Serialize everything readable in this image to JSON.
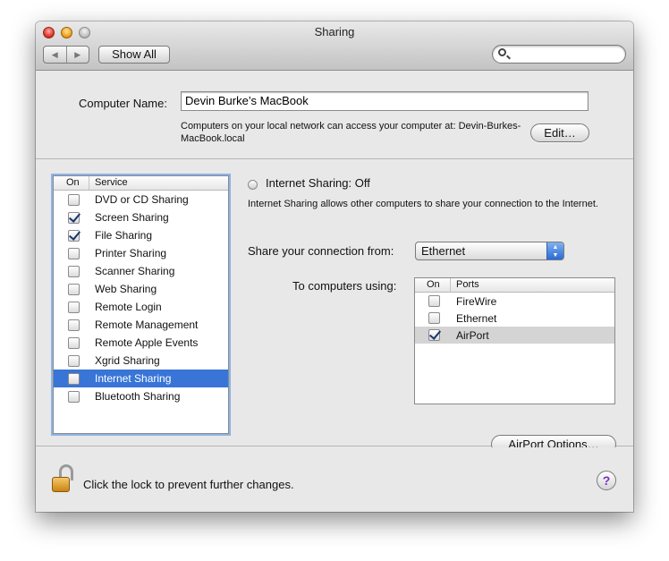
{
  "window": {
    "title": "Sharing"
  },
  "toolbar": {
    "back_icon": "◀",
    "forward_icon": "▶",
    "show_all_label": "Show All",
    "search_placeholder": "",
    "search_value": ""
  },
  "computer": {
    "label": "Computer Name:",
    "name_value": "Devin Burke’s MacBook",
    "description": "Computers on your local network can access your computer at: Devin-Burkes-MacBook.local",
    "edit_label": "Edit…"
  },
  "services": {
    "col_on": "On",
    "col_service": "Service",
    "items": [
      {
        "name": "DVD or CD Sharing",
        "checked": false
      },
      {
        "name": "Screen Sharing",
        "checked": true
      },
      {
        "name": "File Sharing",
        "checked": true
      },
      {
        "name": "Printer Sharing",
        "checked": false
      },
      {
        "name": "Scanner Sharing",
        "checked": false
      },
      {
        "name": "Web Sharing",
        "checked": false
      },
      {
        "name": "Remote Login",
        "checked": false
      },
      {
        "name": "Remote Management",
        "checked": false
      },
      {
        "name": "Remote Apple Events",
        "checked": false
      },
      {
        "name": "Xgrid Sharing",
        "checked": false
      },
      {
        "name": "Internet Sharing",
        "checked": false,
        "selected": true
      },
      {
        "name": "Bluetooth Sharing",
        "checked": false
      }
    ]
  },
  "internet_sharing": {
    "status": "Internet Sharing: Off",
    "description": "Internet Sharing allows other computers to share your connection to the Internet.",
    "share_from_label": "Share your connection from:",
    "share_from_value": "Ethernet",
    "to_computers_label": "To computers using:",
    "col_on": "On",
    "col_ports": "Ports",
    "ports": [
      {
        "name": "FireWire",
        "checked": false
      },
      {
        "name": "Ethernet",
        "checked": false
      },
      {
        "name": "AirPort",
        "checked": true,
        "highlighted": true
      }
    ],
    "airport_options_label": "AirPort Options…"
  },
  "footer": {
    "lock_text": "Click the lock to prevent further changes.",
    "help_label": "?"
  },
  "colors": {
    "selection": "#3875d7",
    "focus_ring": "#8fb3e6",
    "window_bg": "#e8e8e8"
  }
}
